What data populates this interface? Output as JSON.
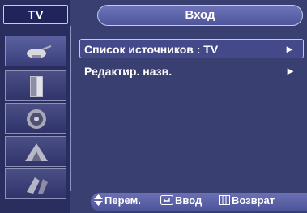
{
  "sidebar": {
    "tab_label": "TV",
    "items": [
      {
        "icon": "antenna-icon"
      },
      {
        "icon": "picture-icon"
      },
      {
        "icon": "speaker-icon"
      },
      {
        "icon": "channel-icon"
      },
      {
        "icon": "setup-icon"
      }
    ]
  },
  "header": {
    "title": "Вход"
  },
  "menu": {
    "items": [
      {
        "label": "Список источников : TV",
        "arrow": "►"
      },
      {
        "label": "Редактир. назв.",
        "arrow": "►"
      }
    ]
  },
  "footer": {
    "move_label": "Перем.",
    "enter_label": "Ввод",
    "back_label": "Возврат"
  },
  "colors": {
    "panel": "#3a3f72",
    "sidebar": "#2a2e5e",
    "title_bar": "#5f65a9",
    "selection": "#44498a",
    "background": "#e9e9e9"
  }
}
